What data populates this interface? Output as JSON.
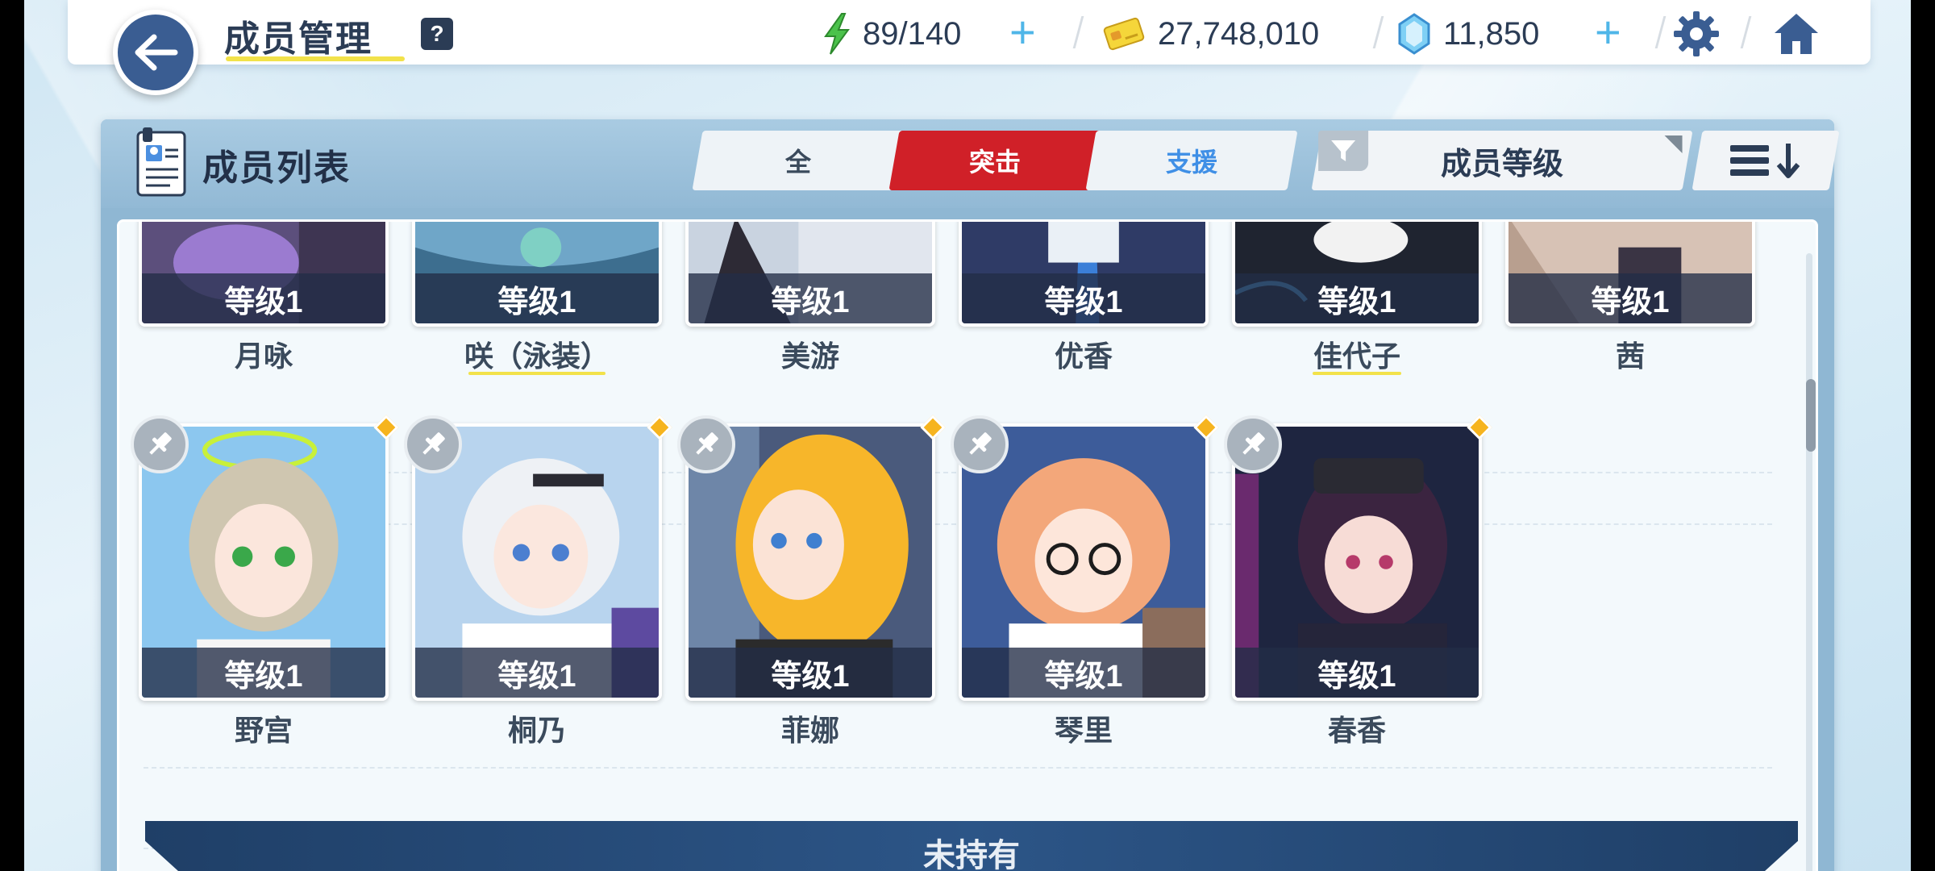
{
  "header": {
    "title": "成员管理",
    "help_label": "?",
    "stamina": "89/140",
    "credits": "27,748,010",
    "pyroxene": "11,850",
    "plus": "+"
  },
  "panel": {
    "title": "成员列表",
    "tabs": [
      {
        "label": "全"
      },
      {
        "label": "突击"
      },
      {
        "label": "支援"
      }
    ],
    "sort_label": "成员等级"
  },
  "cards_row1": [
    {
      "level": "等级1",
      "name": "月咏"
    },
    {
      "level": "等级1",
      "name": "咲（泳装）"
    },
    {
      "level": "等级1",
      "name": "美游"
    },
    {
      "level": "等级1",
      "name": "优香"
    },
    {
      "level": "等级1",
      "name": "佳代子"
    },
    {
      "level": "等级1",
      "name": "茜"
    }
  ],
  "cards_row2": [
    {
      "level": "等级1",
      "name": "野宫"
    },
    {
      "level": "等级1",
      "name": "桐乃"
    },
    {
      "level": "等级1",
      "name": "菲娜"
    },
    {
      "level": "等级1",
      "name": "琴里"
    },
    {
      "level": "等级1",
      "name": "春香"
    }
  ],
  "unowned_label": "未持有",
  "colors": {
    "accent_red": "#d02028",
    "accent_blue": "#3f8fe6",
    "navy": "#2b3c55",
    "highlight_yellow": "#f2e24a"
  },
  "icons": [
    "back-arrow-icon",
    "stamina-bolt-icon",
    "credit-card-icon",
    "pyroxene-gem-icon",
    "gear-icon",
    "home-icon",
    "member-list-icon",
    "filter-icon",
    "sort-icon",
    "pin-icon"
  ]
}
